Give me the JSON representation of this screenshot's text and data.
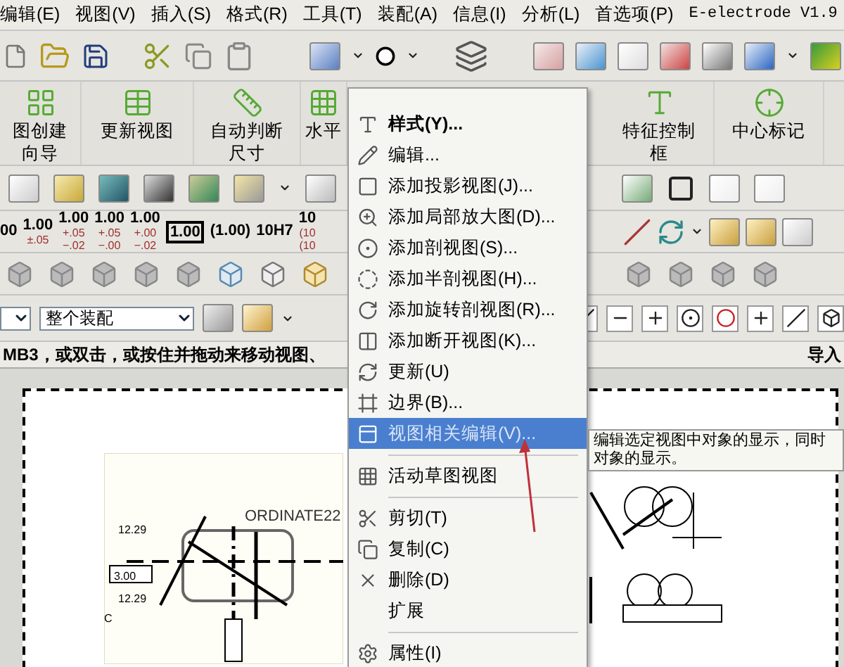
{
  "menu_bar": [
    "编辑(E)",
    "视图(V)",
    "插入(S)",
    "格式(R)",
    "工具(T)",
    "装配(A)",
    "信息(I)",
    "分析(L)",
    "首选项(P)",
    "E-electrode V1.9"
  ],
  "drawing_toolbar": [
    {
      "lines": [
        "图创建",
        "向导"
      ]
    },
    {
      "lines": [
        "更新视图"
      ]
    },
    {
      "lines": [
        "自动判断",
        "尺寸"
      ]
    },
    {
      "lines": [
        "水平"
      ]
    },
    {
      "lines": [
        "特征控制",
        "框"
      ]
    },
    {
      "lines": [
        "中心标记"
      ]
    }
  ],
  "tolerance_toolbar": [
    {
      "kind": "plain",
      "value": "00"
    },
    {
      "kind": "plain",
      "value": "1.00",
      "upper": "±.05"
    },
    {
      "kind": "plain",
      "value": "1.00",
      "upper": "+.05",
      "lower": "−.02"
    },
    {
      "kind": "plain",
      "value": "1.00",
      "upper": "+.05",
      "lower": "−.00"
    },
    {
      "kind": "plain",
      "value": "1.00",
      "upper": "+.00",
      "lower": "−.02"
    },
    {
      "kind": "boxed",
      "value": "1.00"
    },
    {
      "kind": "plain",
      "value": "(1.00)"
    },
    {
      "kind": "plain",
      "value": "10H7"
    },
    {
      "kind": "plain",
      "value": "10",
      "upper": "(10",
      "lower": "(10"
    }
  ],
  "selection_bar": {
    "filter": "整个装配"
  },
  "status_bar": {
    "prompt": "MB3，或双击，或按住并拖动来移动视图、",
    "right": "导入"
  },
  "drawing": {
    "labels": [
      "12.29",
      "3.00",
      "12.29",
      "C",
      "ORDINATE22"
    ]
  },
  "context_menu": [
    {
      "kind": "item",
      "label": "样式(Y)...",
      "default": true,
      "selected": false
    },
    {
      "kind": "item",
      "label": "编辑...",
      "default": false,
      "selected": false
    },
    {
      "kind": "item",
      "label": "添加投影视图(J)...",
      "default": false,
      "selected": false
    },
    {
      "kind": "item",
      "label": "添加局部放大图(D)...",
      "default": false,
      "selected": false
    },
    {
      "kind": "item",
      "label": "添加剖视图(S)...",
      "default": false,
      "selected": false
    },
    {
      "kind": "item",
      "label": "添加半剖视图(H)...",
      "default": false,
      "selected": false
    },
    {
      "kind": "item",
      "label": "添加旋转剖视图(R)...",
      "default": false,
      "selected": false
    },
    {
      "kind": "item",
      "label": "添加断开视图(K)...",
      "default": false,
      "selected": false
    },
    {
      "kind": "item",
      "label": "更新(U)",
      "default": false,
      "selected": false
    },
    {
      "kind": "item",
      "label": "边界(B)...",
      "default": false,
      "selected": false
    },
    {
      "kind": "item",
      "label": "视图相关编辑(V)...",
      "default": false,
      "selected": true
    },
    {
      "kind": "separator"
    },
    {
      "kind": "item",
      "label": "活动草图视图",
      "default": false,
      "selected": false
    },
    {
      "kind": "separator"
    },
    {
      "kind": "item",
      "label": "剪切(T)",
      "default": false,
      "selected": false
    },
    {
      "kind": "item",
      "label": "复制(C)",
      "default": false,
      "selected": false
    },
    {
      "kind": "item",
      "label": "删除(D)",
      "default": false,
      "selected": false
    },
    {
      "kind": "item",
      "label": "扩展",
      "default": false,
      "selected": false
    },
    {
      "kind": "separator"
    },
    {
      "kind": "item",
      "label": "属性(I)",
      "default": false,
      "selected": false
    }
  ],
  "tooltip": {
    "lines": [
      "编辑选定视图中对象的显示，同时",
      "对象的显示。"
    ]
  }
}
